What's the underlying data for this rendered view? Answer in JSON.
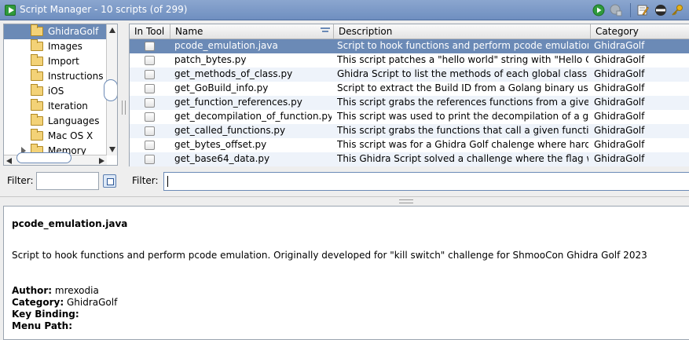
{
  "window": {
    "title": "Script Manager - 10 scripts  (of 299)"
  },
  "toolbar": {
    "icons": [
      "run-script-icon",
      "run-last-script-icon",
      "edit-script-icon",
      "manage-bundles-icon",
      "key-binding-icon"
    ]
  },
  "category_tree": {
    "items": [
      {
        "label": "GhidraGolf",
        "selected": true,
        "expandable": false
      },
      {
        "label": "Images",
        "selected": false,
        "expandable": false
      },
      {
        "label": "Import",
        "selected": false,
        "expandable": false
      },
      {
        "label": "Instructions",
        "selected": false,
        "expandable": false
      },
      {
        "label": "iOS",
        "selected": false,
        "expandable": false
      },
      {
        "label": "Iteration",
        "selected": false,
        "expandable": false
      },
      {
        "label": "Languages",
        "selected": false,
        "expandable": false
      },
      {
        "label": "Mac OS X",
        "selected": false,
        "expandable": false
      },
      {
        "label": "Memory",
        "selected": false,
        "expandable": true
      }
    ],
    "filter_label": "Filter:",
    "filter_value": ""
  },
  "script_table": {
    "headers": [
      "In Tool",
      "Name",
      "Description",
      "Category"
    ],
    "rows": [
      {
        "name": "pcode_emulation.java",
        "description": "Script to hook functions and perform pcode emulation. Or...",
        "category": "GhidraGolf",
        "selected": true
      },
      {
        "name": "patch_bytes.py",
        "description": "This script patches a \"hello world\" string with \"Hello Ghid...",
        "category": "GhidraGolf",
        "selected": false
      },
      {
        "name": "get_methods_of_class.py",
        "description": "Ghidra Script to list the methods of each global class con...",
        "category": "GhidraGolf",
        "selected": false
      },
      {
        "name": "get_GoBuild_info.py",
        "description": "Script to extract the Build ID from a Golang binary using ...",
        "category": "GhidraGolf",
        "selected": false
      },
      {
        "name": "get_function_references.py",
        "description": "This script grabs the references functions from a given fu...",
        "category": "GhidraGolf",
        "selected": false
      },
      {
        "name": "get_decompilation_of_function.py",
        "description": "This script was used to print the decompilation of a given...",
        "category": "GhidraGolf",
        "selected": false
      },
      {
        "name": "get_called_functions.py",
        "description": "This script grabs the functions that call a given function",
        "category": "GhidraGolf",
        "selected": false
      },
      {
        "name": "get_bytes_offset.py",
        "description": "This script was for a Ghidra Golf chalenge where hardco...",
        "category": "GhidraGolf",
        "selected": false
      },
      {
        "name": "get_base64_data.py",
        "description": "This Ghidra Script solved a challenge where the flag was...",
        "category": "GhidraGolf",
        "selected": false
      }
    ],
    "filter_label": "Filter:",
    "filter_value": ""
  },
  "details": {
    "name": "pcode_emulation.java",
    "description": "Script to hook functions and perform pcode emulation. Originally developed for \"kill switch\" challenge for ShmooCon Ghidra Golf 2023",
    "author_label": "Author:",
    "author_value": "mrexodia",
    "category_label": "Category:",
    "category_value": "GhidraGolf",
    "key_binding_label": "Key Binding:",
    "key_binding_value": "",
    "menu_path_label": "Menu Path:",
    "menu_path_value": ""
  },
  "colors": {
    "title_bar": "#7a98c6",
    "selection": "#6b8ab6",
    "alt_row": "#eef3fa",
    "folder": "#f3d277"
  }
}
